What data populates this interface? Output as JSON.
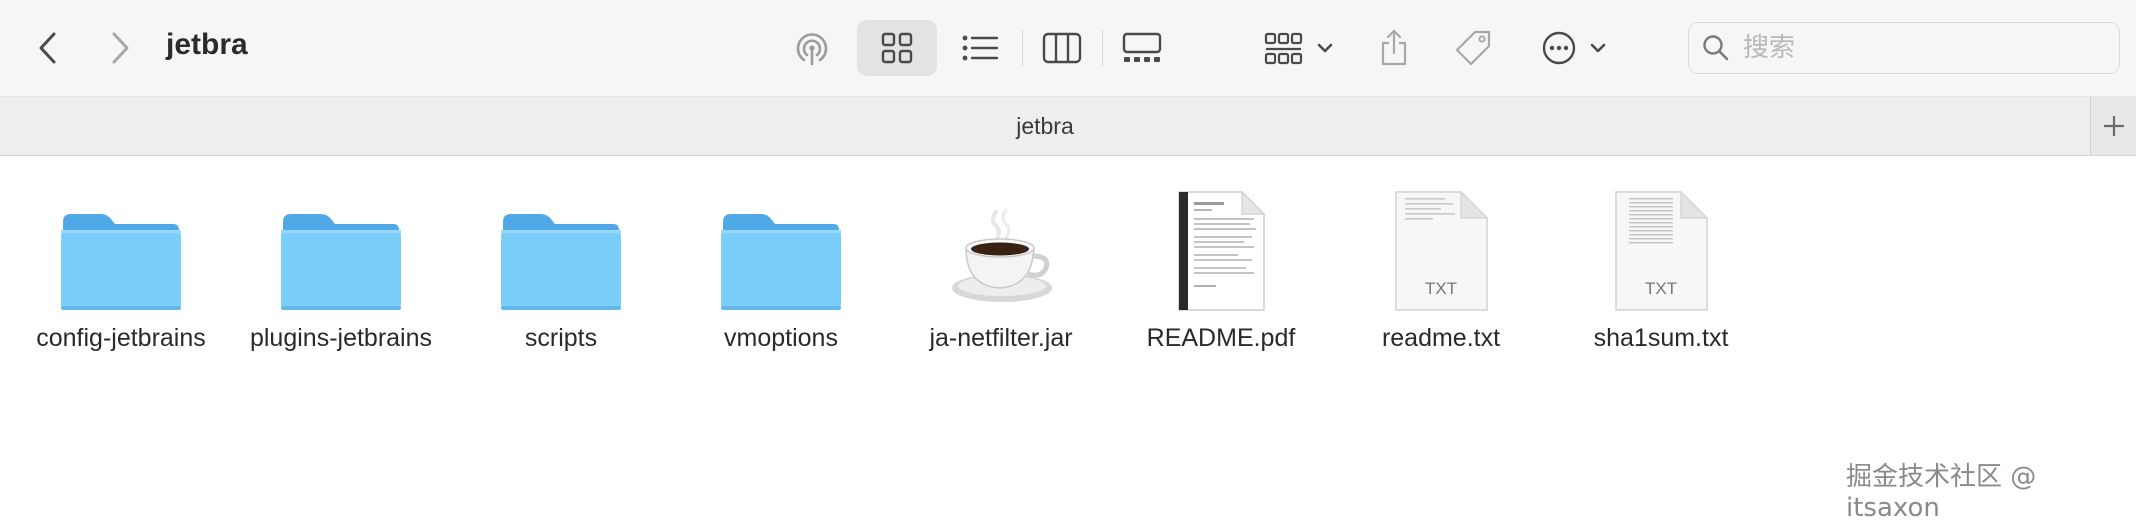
{
  "window": {
    "title": "jetbra"
  },
  "toolbar": {
    "back_icon": "chevron-left-icon",
    "forward_icon": "chevron-right-icon",
    "airdrop_icon": "airdrop-icon",
    "view_modes": [
      "icon-view",
      "list-view",
      "column-view",
      "gallery-view"
    ],
    "active_view": "icon-view",
    "group_icon": "group-by-icon",
    "share_icon": "share-icon",
    "tag_icon": "tag-icon",
    "more_icon": "more-actions-icon",
    "search": {
      "placeholder": "搜索",
      "value": ""
    }
  },
  "tabbar": {
    "tab_label": "jetbra",
    "add_label": "+"
  },
  "files": [
    {
      "name": "config-jetbrains",
      "kind": "folder"
    },
    {
      "name": "plugins-jetbrains",
      "kind": "folder"
    },
    {
      "name": "scripts",
      "kind": "folder"
    },
    {
      "name": "vmoptions",
      "kind": "folder"
    },
    {
      "name": "ja-netfilter.jar",
      "kind": "jar"
    },
    {
      "name": "README.pdf",
      "kind": "pdf"
    },
    {
      "name": "readme.txt",
      "kind": "txt",
      "badge": "TXT"
    },
    {
      "name": "sha1sum.txt",
      "kind": "txt",
      "badge": "TXT"
    }
  ],
  "watermark": "掘金技术社区 @ itsaxon",
  "colors": {
    "folder_front": "#7bcdfa",
    "folder_back": "#4fa9e6",
    "toolbar_bg": "#f6f6f6",
    "selected_bg": "#e3e3e3"
  }
}
